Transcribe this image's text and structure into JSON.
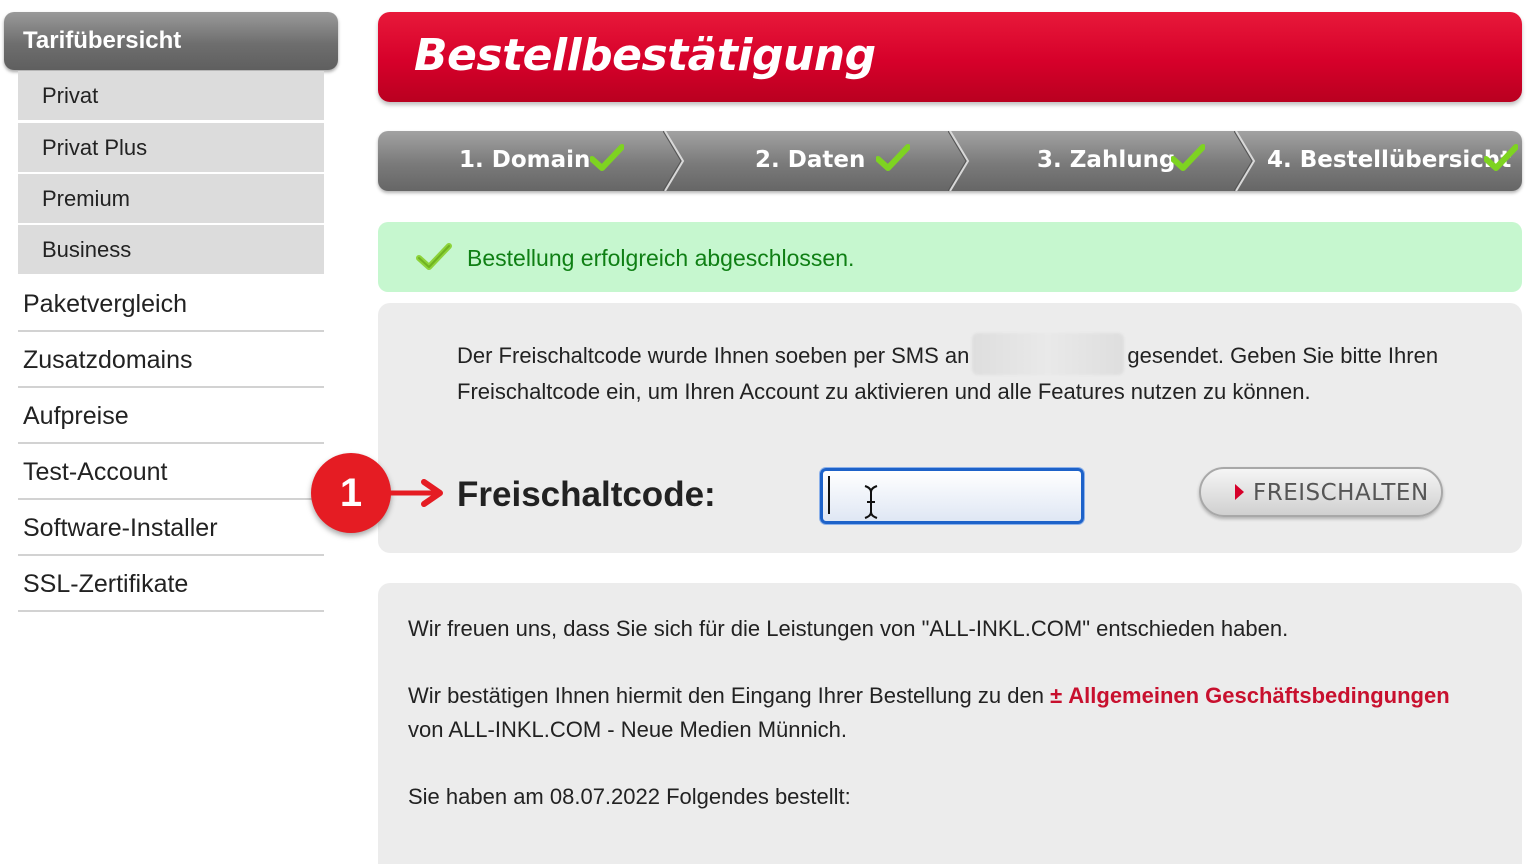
{
  "sidebar": {
    "header": "Tarifübersicht",
    "sub_items": [
      {
        "label": "Privat"
      },
      {
        "label": "Privat Plus"
      },
      {
        "label": "Premium"
      },
      {
        "label": "Business"
      }
    ],
    "items": [
      {
        "label": "Paketvergleich"
      },
      {
        "label": "Zusatzdomains"
      },
      {
        "label": "Aufpreise"
      },
      {
        "label": "Test-Account"
      },
      {
        "label": "Software-Installer"
      },
      {
        "label": "SSL-Zertifikate"
      }
    ]
  },
  "banner": {
    "title": "Bestellbestätigung"
  },
  "steps": [
    {
      "label": "1. Domain",
      "icon": "check-icon"
    },
    {
      "label": "2. Daten",
      "icon": "check-icon"
    },
    {
      "label": "3. Zahlung",
      "icon": "check-icon"
    },
    {
      "label": "4. Bestellübersicht",
      "icon": "check-icon"
    }
  ],
  "success": {
    "message": "Bestellung erfolgreich abgeschlossen."
  },
  "code": {
    "text_before": "Der Freischaltcode wurde Ihnen soeben per SMS an",
    "text_after": "gesendet. Geben Sie bitte Ihren Freischaltcode ein, um Ihren Account zu aktivieren und alle Features nutzen zu können.",
    "label": "Freischaltcode:",
    "input_value": "",
    "button_label": "FREISCHALTEN"
  },
  "annotation": {
    "number": "1"
  },
  "order": {
    "p1": "Wir freuen uns, dass Sie sich für die Leistungen von \"ALL-INKL.COM\" entschieden haben.",
    "p2_before": "Wir bestätigen Ihnen hiermit den Eingang Ihrer Bestellung zu den",
    "download_icon": "±",
    "agb_link": "Allgemeinen Geschäftsbedingungen",
    "p2_after": "von ALL-INKL.COM - Neue Medien Münnich.",
    "p3": "Sie haben am 08.07.2022 Folgendes bestellt:"
  },
  "colors": {
    "brand_red": "#d6002a",
    "check_green": "#7ed321",
    "success_bg": "#c6f7cf",
    "success_text": "#0f7f14"
  }
}
